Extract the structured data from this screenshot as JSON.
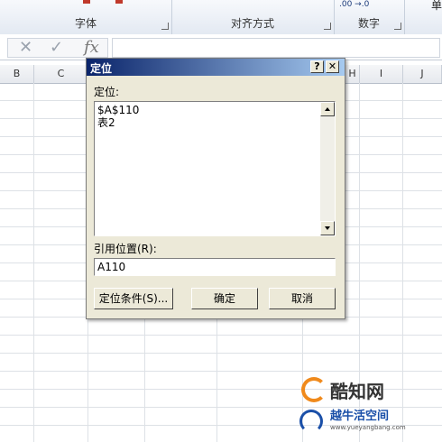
{
  "ribbon": {
    "groups": [
      {
        "label": "字体"
      },
      {
        "label": "对齐方式"
      },
      {
        "label": "数字"
      }
    ],
    "number_format_hint": ".00  →.0",
    "cut_label": "单"
  },
  "formula_bar": {
    "fx_label": "fx",
    "cancel_glyph": "✕",
    "enter_glyph": "✓",
    "value": ""
  },
  "columns": [
    "B",
    "C",
    "H",
    "I",
    "J"
  ],
  "dialog": {
    "title": "定位",
    "help_glyph": "?",
    "close_glyph": "✕",
    "goto_label": "定位:",
    "goto_items": [
      "$A$110",
      "表2"
    ],
    "reference_label": "引用位置(R):",
    "reference_value": "A110",
    "special_button": "定位条件(S)...",
    "ok_button": "确定",
    "cancel_button": "取消"
  },
  "watermark": {
    "line1": "酷知网",
    "line2": "越牛活空间",
    "line3": "www.yueyangbang.com",
    "brand_colors": {
      "orange": "#f08a1c",
      "blue": "#1a4fa8"
    }
  }
}
